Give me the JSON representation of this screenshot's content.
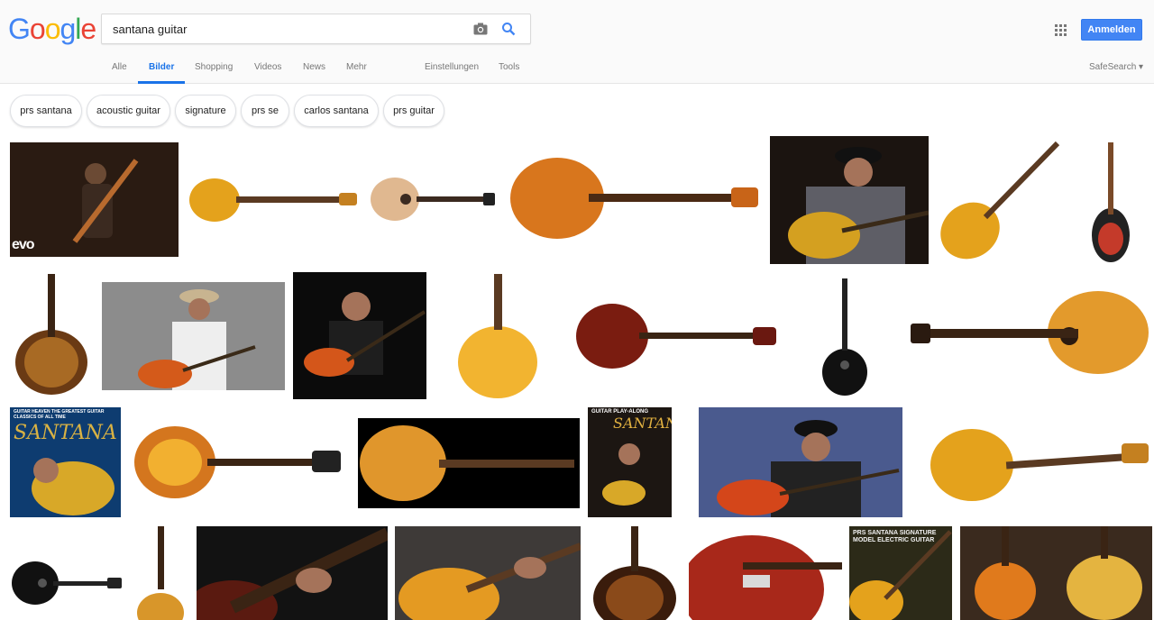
{
  "logo": {
    "text": "Google",
    "letters": [
      "G",
      "o",
      "o",
      "g",
      "l",
      "e"
    ],
    "colors": [
      "#4285f4",
      "#ea4335",
      "#fbbc05",
      "#4285f4",
      "#34a853",
      "#ea4335"
    ]
  },
  "search": {
    "value": "santana guitar",
    "camera_icon": "camera-icon",
    "search_icon": "search-icon"
  },
  "header": {
    "apps_icon": "apps-grid-icon",
    "signin_label": "Anmelden"
  },
  "tabs": [
    {
      "label": "Alle",
      "active": false
    },
    {
      "label": "Bilder",
      "active": true
    },
    {
      "label": "Shopping",
      "active": false
    },
    {
      "label": "Videos",
      "active": false
    },
    {
      "label": "News",
      "active": false
    },
    {
      "label": "Mehr",
      "active": false
    },
    {
      "label": "Einstellungen",
      "active": false
    },
    {
      "label": "Tools",
      "active": false
    }
  ],
  "safesearch": {
    "label": "SafeSearch ▾"
  },
  "chips": [
    "prs santana",
    "acoustic guitar",
    "signature",
    "prs se",
    "carlos santana",
    "prs guitar"
  ],
  "results": {
    "vevo_badge": "evo",
    "cover1_text": "GUITAR HEAVEN THE GREATEST GUITAR CLASSICS OF ALL TIME",
    "cover1_brand": "SANTANA",
    "cover2_text": "GUITAR PLAY-ALONG",
    "cover2_brand": "SANTANA",
    "book_text": "PRS SANTANA SIGNATURE MODEL ELECTRIC GUITAR"
  }
}
